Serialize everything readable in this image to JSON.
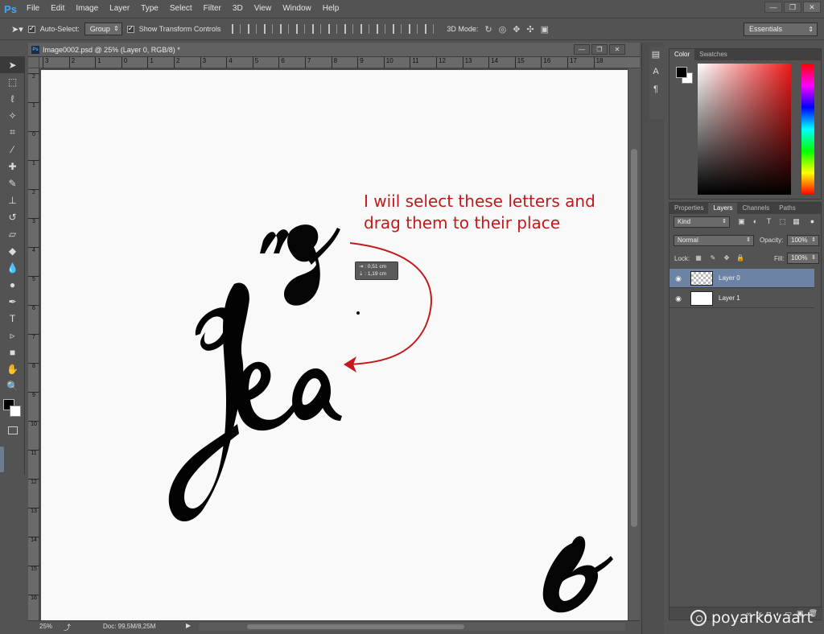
{
  "app": {
    "logo": "Ps",
    "menu": [
      "File",
      "Edit",
      "Image",
      "Layer",
      "Type",
      "Select",
      "Filter",
      "3D",
      "View",
      "Window",
      "Help"
    ],
    "window_controls": [
      "minimize",
      "restore",
      "close"
    ]
  },
  "options_bar": {
    "auto_select_label": "Auto-Select:",
    "auto_select_checked": true,
    "auto_select_value": "Group",
    "transform_label": "Show Transform Controls",
    "transform_checked": true,
    "mode_3d_label": "3D Mode:",
    "workspace": "Essentials"
  },
  "document": {
    "tab_title": "Image0002.psd @ 25% (Layer 0, RGB/8) *",
    "ruler_h_ticks": [
      "3",
      "2",
      "1",
      "0",
      "1",
      "2",
      "3",
      "4",
      "5",
      "6",
      "7",
      "8",
      "9",
      "10",
      "11",
      "12",
      "13",
      "14",
      "15",
      "16",
      "17",
      "18"
    ],
    "ruler_v_ticks": [
      "2",
      "1",
      "0",
      "1",
      "2",
      "3",
      "4",
      "5",
      "6",
      "7",
      "8",
      "9",
      "10",
      "11",
      "12",
      "13",
      "14",
      "15",
      "16"
    ],
    "zoom": "25%",
    "doc_size": "Doc: 99,5M/8,25M"
  },
  "canvas": {
    "annotation_line1": "I wiil select these letters and",
    "annotation_line2": "drag them to their place",
    "measure_dx": "⇥ :  0,51 cm",
    "measure_dy": "⇣ :  1,19 cm",
    "annotation_color": "#c4191a"
  },
  "color_panel": {
    "tabs": [
      "Color",
      "Swatches"
    ],
    "active_tab": "Color",
    "foreground": "#000000",
    "background": "#ffffff"
  },
  "layers_panel": {
    "tabs": [
      "Properties",
      "Layers",
      "Channels",
      "Paths"
    ],
    "active_tab": "Layers",
    "filter_kind": "Kind",
    "blend_mode": "Normal",
    "opacity_label": "Opacity:",
    "opacity": "100%",
    "lock_label": "Lock:",
    "fill_label": "Fill:",
    "fill": "100%",
    "layers": [
      {
        "name": "Layer 0",
        "selected": true,
        "thumb": "transparent"
      },
      {
        "name": "Layer 1",
        "selected": false,
        "thumb": "white"
      }
    ]
  },
  "watermark": "poyarkovaart"
}
